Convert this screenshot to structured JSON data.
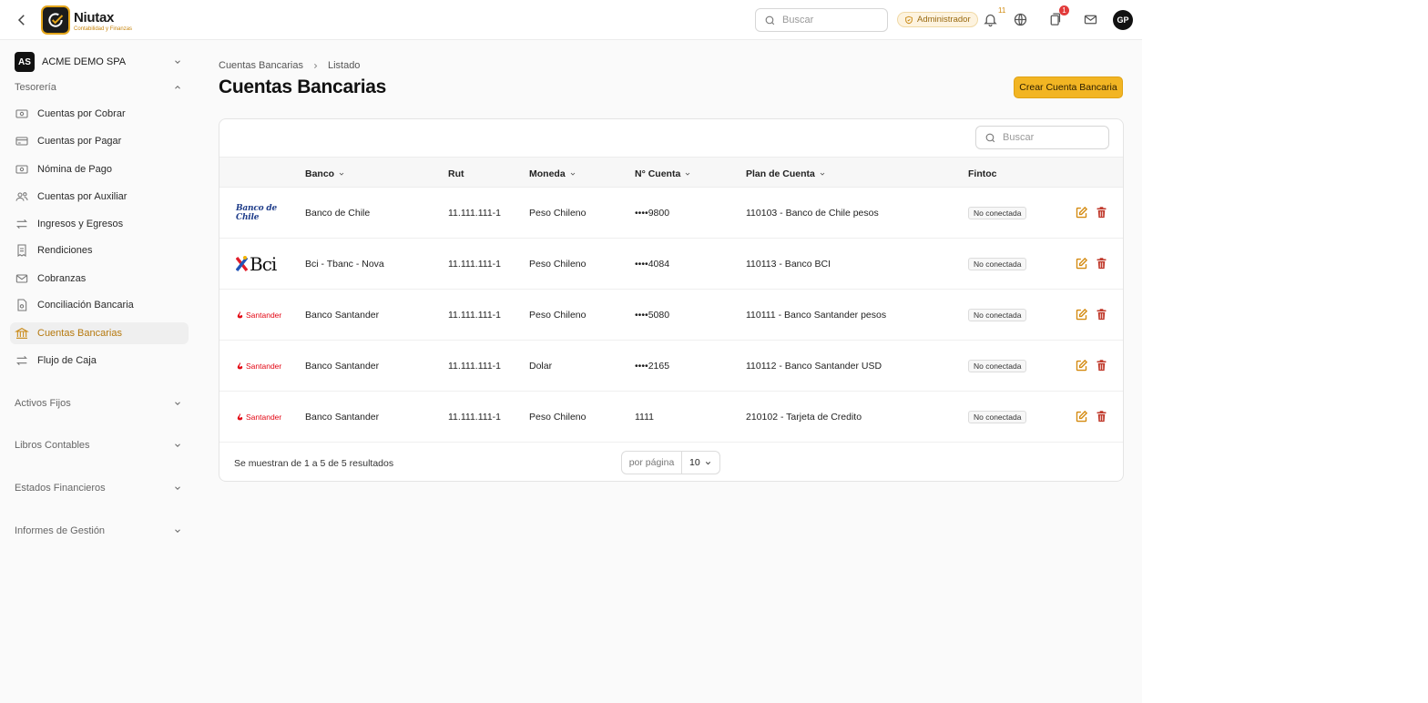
{
  "header": {
    "brand_name": "Niutax",
    "brand_tagline": "Contabilidad y Finanzas",
    "search_placeholder": "Buscar",
    "role_badge": "Administrador",
    "notifications_count": "11",
    "tasks_count": "1",
    "avatar_initials": "GP"
  },
  "sidebar": {
    "company_initials": "AS",
    "company_name": "ACME DEMO SPA",
    "section_open": "Tesorería",
    "items": [
      {
        "label": "Cuentas por Cobrar",
        "icon": "money-icon"
      },
      {
        "label": "Cuentas por Pagar",
        "icon": "card-icon"
      },
      {
        "label": "Nómina de Pago",
        "icon": "money-icon"
      },
      {
        "label": "Cuentas por Auxiliar",
        "icon": "users-icon"
      },
      {
        "label": "Ingresos y Egresos",
        "icon": "arrows-icon"
      },
      {
        "label": "Rendiciones",
        "icon": "receipt-icon"
      },
      {
        "label": "Cobranzas",
        "icon": "mail-icon"
      },
      {
        "label": "Conciliación Bancaria",
        "icon": "document-icon"
      },
      {
        "label": "Cuentas Bancarias",
        "icon": "bank-icon",
        "active": true
      },
      {
        "label": "Flujo de Caja",
        "icon": "arrows-icon"
      }
    ],
    "collapsed_sections": [
      "Activos Fijos",
      "Libros Contables",
      "Estados Financieros",
      "Informes de Gestión"
    ]
  },
  "main": {
    "breadcrumb": [
      "Cuentas Bancarias",
      "Listado"
    ],
    "title": "Cuentas Bancarias",
    "create_button": "Crear Cuenta Bancaria",
    "table_search_placeholder": "Buscar",
    "columns": [
      "Banco",
      "Rut",
      "Moneda",
      "N° Cuenta",
      "Plan de Cuenta",
      "Fintoc"
    ],
    "rows": [
      {
        "logo": "Banco de Chile",
        "bank": "Banco de Chile",
        "rut": "11.111.111-1",
        "currency": "Peso Chileno",
        "account": "••••9800",
        "plan": "110103 - Banco de Chile pesos",
        "fintoc": "No conectada"
      },
      {
        "logo": "Bci",
        "bank": "Bci - Tbanc - Nova",
        "rut": "11.111.111-1",
        "currency": "Peso Chileno",
        "account": "••••4084",
        "plan": "110113 - Banco BCI",
        "fintoc": "No conectada"
      },
      {
        "logo": "Santander",
        "bank": "Banco Santander",
        "rut": "11.111.111-1",
        "currency": "Peso Chileno",
        "account": "••••5080",
        "plan": "110111 - Banco Santander pesos",
        "fintoc": "No conectada"
      },
      {
        "logo": "Santander",
        "bank": "Banco Santander",
        "rut": "11.111.111-1",
        "currency": "Dolar",
        "account": "••••2165",
        "plan": "110112 - Banco Santander USD",
        "fintoc": "No conectada"
      },
      {
        "logo": "Santander",
        "bank": "Banco Santander",
        "rut": "11.111.111-1",
        "currency": "Peso Chileno",
        "account": "1111",
        "plan": "210102 - Tarjeta de Credito",
        "fintoc": "No conectada"
      }
    ],
    "results_text": "Se muestran de 1 a 5 de 5 resultados",
    "per_page_label": "por página",
    "per_page_value": "10"
  },
  "colors": {
    "accent": "#f2b523",
    "active_text": "#b5780d",
    "delete": "#c0392b"
  }
}
